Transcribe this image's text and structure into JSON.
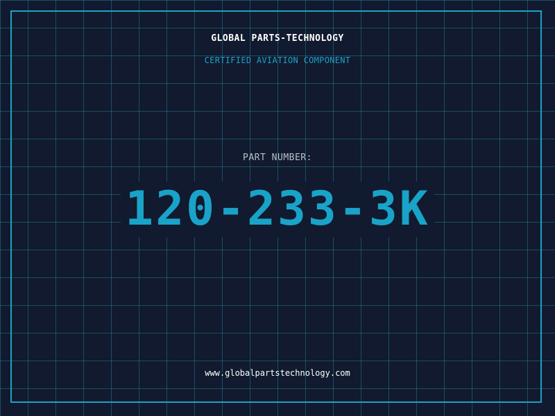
{
  "header": {
    "company": "GLOBAL PARTS-TECHNOLOGY",
    "tagline": "CERTIFIED AVIATION COMPONENT"
  },
  "part": {
    "label": "PART NUMBER:",
    "number": "120-233-3K"
  },
  "footer": {
    "website": "www.globalpartstechnology.com"
  },
  "colors": {
    "background": "#111a2e",
    "grid": "#217896",
    "accent": "#1aa3c8",
    "label": "#b7c0cc",
    "text": "#ffffff"
  }
}
